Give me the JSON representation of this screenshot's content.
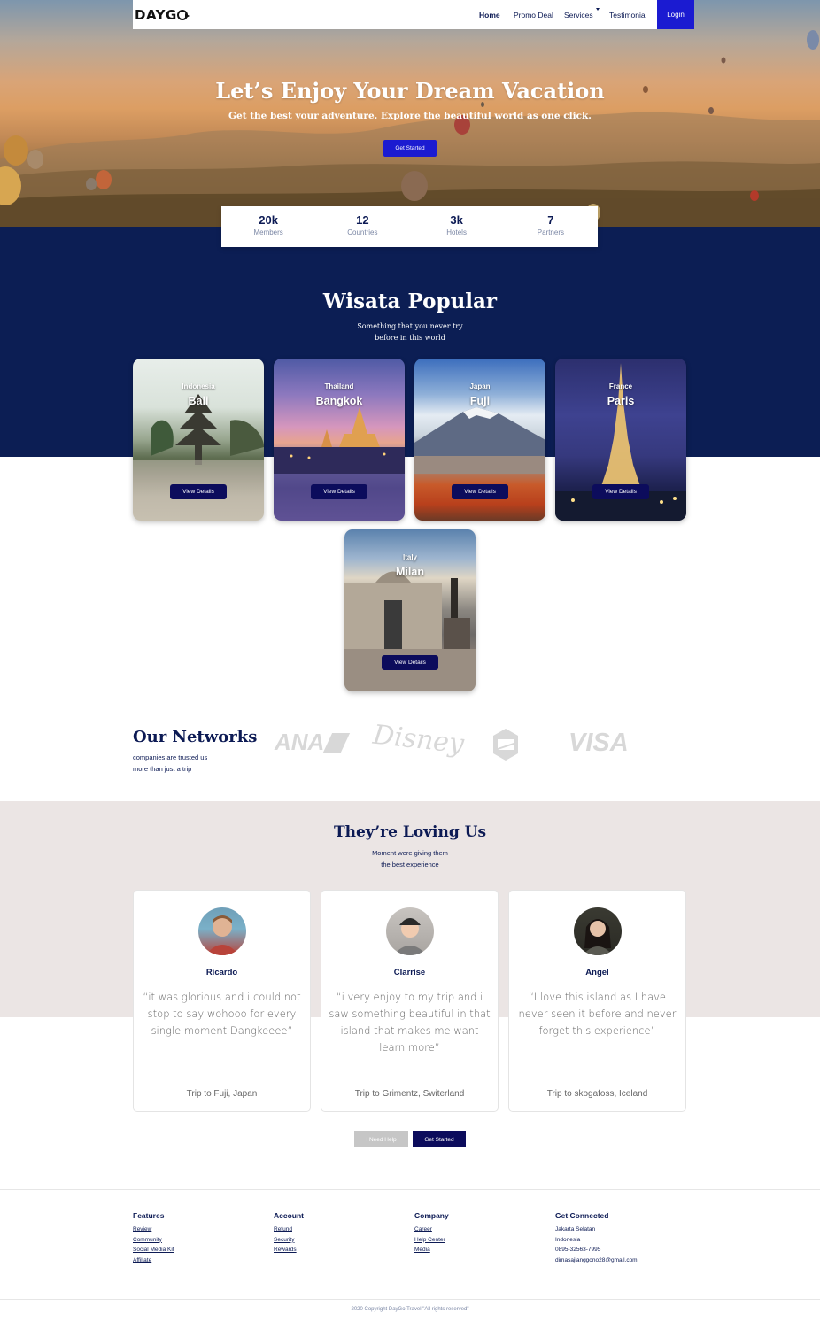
{
  "nav": {
    "logo": "DAYGO",
    "items": [
      "Home",
      "Promo Deal",
      "Services",
      "Testimonial"
    ],
    "login": "Login"
  },
  "hero": {
    "title": "Let’s Enjoy Your Dream Vacation",
    "subtitle": "Get the best your adventure. Explore the beautiful world as one click.",
    "button": "Get Started"
  },
  "stats": [
    {
      "value": "20k",
      "label": "Members"
    },
    {
      "value": "12",
      "label": "Countries"
    },
    {
      "value": "3k",
      "label": "Hotels"
    },
    {
      "value": "7",
      "label": "Partners"
    }
  ],
  "popular": {
    "title": "Wisata Popular",
    "subtitle_line1": "Something that you never try",
    "subtitle_line2": "before in this world",
    "cards": [
      {
        "country": "Indonesia",
        "city": "Bali",
        "button": "View Details"
      },
      {
        "country": "Thailand",
        "city": "Bangkok",
        "button": "View Details"
      },
      {
        "country": "Japan",
        "city": "Fuji",
        "button": "View Details"
      },
      {
        "country": "France",
        "city": "Paris",
        "button": "View Details"
      },
      {
        "country": "Italy",
        "city": "Milan",
        "button": "View Details"
      }
    ]
  },
  "networks": {
    "title": "Our Networks",
    "subtitle_line1": "companies are trusted us",
    "subtitle_line2": "more than just a trip",
    "brands": [
      "ANA",
      "Disney",
      "shield-logo",
      "VISA"
    ]
  },
  "testimonials": {
    "title": "They’re Loving Us",
    "subtitle_line1": "Moment were giving them",
    "subtitle_line2": "the best experience",
    "items": [
      {
        "name": "Ricardo",
        "quote": "“it was glorious and i could not stop to say wohooo for every single moment Dangkeeee”",
        "trip": "Trip to Fuji, Japan"
      },
      {
        "name": "Clarrise",
        "quote": "“i very enjoy to my trip and i saw something beautiful in that island that makes me want learn more”",
        "trip": "Trip to Grimentz, Switerland"
      },
      {
        "name": "Angel",
        "quote": "“I love this island as I have never seen it before and never forget this experience”",
        "trip": "Trip to skogafoss, Iceland"
      }
    ],
    "help_button": "I Need Help",
    "start_button": "Get Started"
  },
  "footer": {
    "features": {
      "title": "Features",
      "links": [
        "Review",
        "Community",
        "Social Media Kit",
        "Affiliate"
      ]
    },
    "account": {
      "title": "Account",
      "links": [
        "Refund",
        "Security",
        "Rewards"
      ]
    },
    "company": {
      "title": "Company",
      "links": [
        "Career",
        "Help Center",
        "Media"
      ]
    },
    "connected": {
      "title": "Get Connected",
      "lines": [
        "Jakarta Selatan",
        "Indonesia",
        "0895-32563-7995",
        "dimasajianggono28@gmail.com"
      ]
    },
    "copyright": "2020 Copyright DayGo Travel \"All rights reserved\""
  },
  "colors": {
    "navy": "#0c1e54",
    "accent_blue": "#1b1bd1",
    "dark_button": "#0c0c5c",
    "testimonial_bg": "#ebe5e4"
  }
}
